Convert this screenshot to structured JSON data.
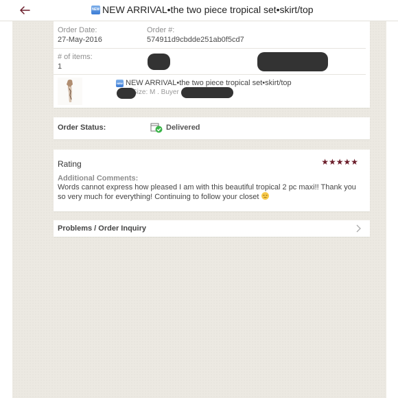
{
  "header": {
    "back_icon": "arrow-left-icon",
    "badge_text": "NEW",
    "title": "NEW ARRIVAL•the two piece tropical set•skirt/top"
  },
  "order": {
    "date_label": "Order Date:",
    "date_value": "27-May-2016",
    "number_label": "Order #:",
    "number_value": "574911d9cbdde251ab0f5cd7",
    "items_label": "# of items:",
    "items_value": "1",
    "item": {
      "badge_text": "NEW",
      "title": "NEW ARRIVAL•the two piece tropical set•skirt/top",
      "size_text": "Size: M . Buyer"
    }
  },
  "status": {
    "label": "Order Status:",
    "value": "Delivered",
    "icon": "delivered-box-check-icon"
  },
  "rating": {
    "title": "Rating",
    "stars": "★★★★★",
    "star_count": 5,
    "comments_label": "Additional Comments:",
    "comments_text": "Words cannot express how pleased I am with this beautiful tropical 2 pc maxi!! Thank you so very much for everything! Continuing to follow your closet"
  },
  "problems": {
    "label": "Problems / Order Inquiry",
    "icon": "chevron-right-icon"
  },
  "colors": {
    "accent": "#6b1d2a",
    "success": "#3cb54a",
    "background": "#ece9e2"
  }
}
